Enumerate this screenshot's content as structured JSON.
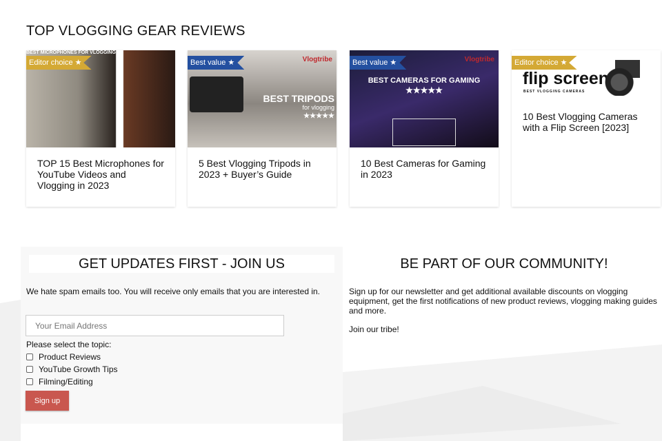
{
  "section_title": "TOP VLOGGING GEAR REVIEWS",
  "cards": [
    {
      "badge": "Editor choice ★",
      "badge_color": "#d4a935",
      "image_text": "BEST MICROPHONES FOR VLOGGING",
      "title": "TOP 15 Best Microphones for YouTube Videos and Vlogging in 2023"
    },
    {
      "badge": "Best value ★",
      "badge_color": "#2450a0",
      "logo": "Vlogtribe",
      "image_text": "BEST TRIPODS",
      "image_subtext": "for vlogging",
      "image_stars": "★★★★★",
      "title": "5 Best Vlogging Tripods in 2023 + Buyer’s Guide"
    },
    {
      "badge": "Best value ★",
      "badge_color": "#2450a0",
      "logo": "Vlogtribe",
      "image_text": "BEST CAMERAS FOR GAMING",
      "image_stars": "★★★★★",
      "title": "10 Best Cameras for Gaming in 2023"
    },
    {
      "badge": "Editor choice ★",
      "badge_color": "#d4a935",
      "image_text": "flip screen",
      "image_subtext": "BEST VLOGGING CAMERAS",
      "title": "10 Best Vlogging Cameras with a Flip Screen [2023]"
    }
  ],
  "newsletter": {
    "heading": "GET UPDATES FIRST - JOIN US",
    "note": "We hate spam emails too. You will receive only emails that you are interested in.",
    "email_placeholder": "Your Email Address",
    "topic_label": "Please select the topic:",
    "topics": [
      "Product Reviews",
      "YouTube Growth Tips",
      "Filming/Editing"
    ],
    "submit": "Sign up"
  },
  "community": {
    "heading": "BE PART OF OUR COMMUNITY!",
    "text": "Sign up for our newsletter and get additional available discounts on vlogging equipment, get the first notifications of new product reviews, vlogging making guides and more.",
    "cta": "Join our tribe!"
  }
}
